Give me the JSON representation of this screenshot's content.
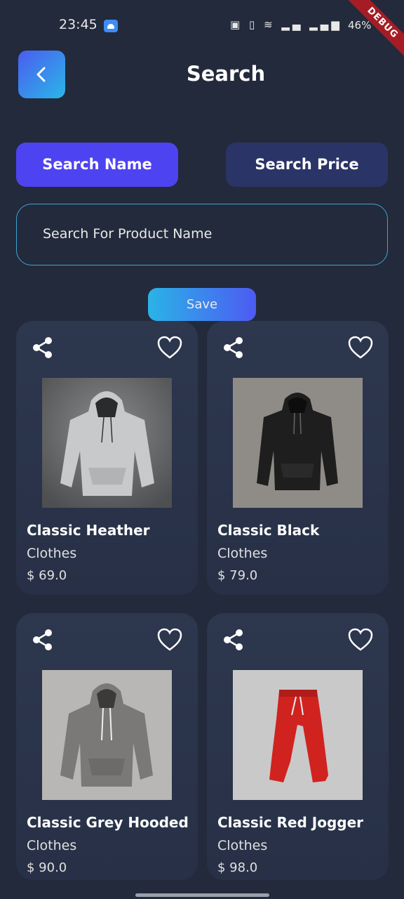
{
  "status_bar": {
    "time": "23:45",
    "icons": "▣ ▯ ≋ ▂▄ ▂▄▆",
    "battery": "46%",
    "debug": "DEBUG"
  },
  "header": {
    "title": "Search",
    "back_icon": "chevron-left-icon"
  },
  "search_tabs": [
    {
      "label": "Search Name",
      "active": true
    },
    {
      "label": "Search Price",
      "active": false
    }
  ],
  "search": {
    "placeholder": "Search For Product Name",
    "value": ""
  },
  "save_label": "Save",
  "colors": {
    "background": "#232a3b",
    "active_tab": "#4e43f0",
    "inactive_tab": "#2b3466",
    "accent": "#3aa6d6"
  },
  "products": [
    {
      "name": "Classic Heather",
      "category": "Clothes",
      "price": "$ 69.0",
      "image": "grey-hoodie"
    },
    {
      "name": "Classic Black",
      "category": "Clothes",
      "price": "$ 79.0",
      "image": "black-hoodie"
    },
    {
      "name": "Classic Grey Hooded",
      "category": "Clothes",
      "price": "$ 90.0",
      "image": "grey-hooded"
    },
    {
      "name": "Classic Red Jogger",
      "category": "Clothes",
      "price": "$ 98.0",
      "image": "red-jogger"
    }
  ]
}
